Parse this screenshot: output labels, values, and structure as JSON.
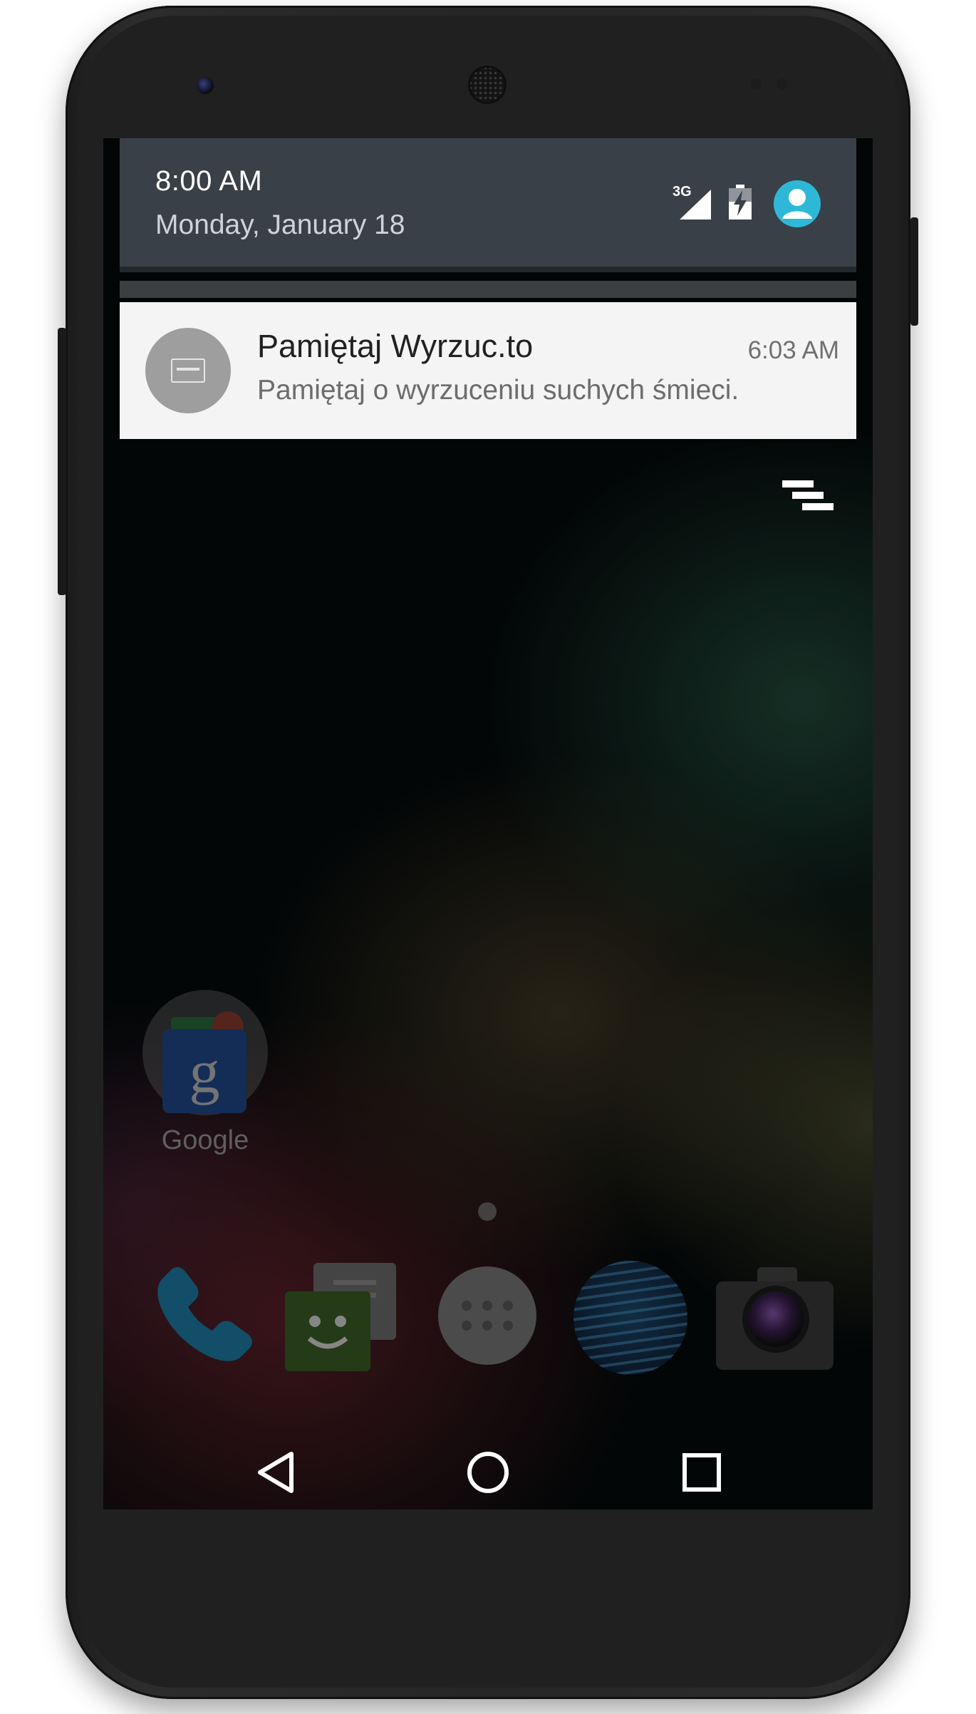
{
  "status": {
    "time": "8:00 AM",
    "date": "Monday, January 18",
    "network_label": "3G",
    "icons": [
      "signal-icon",
      "battery-charging-icon",
      "user-avatar-icon"
    ]
  },
  "notification": {
    "app_icon": "app-icon",
    "title": "Pamiętaj Wyrzuc.to",
    "time": "6:03 AM",
    "text": "Pamiętaj o wyrzuceniu suchych śmieci."
  },
  "clear_all_icon": "clear-all-icon",
  "home": {
    "folder_label": "Google",
    "folder_glyph": "g",
    "dock": [
      "phone-icon",
      "messenger-icon",
      "app-drawer-icon",
      "browser-icon",
      "camera-icon"
    ]
  },
  "navbar": {
    "buttons": [
      "back-icon",
      "home-icon",
      "recents-icon"
    ]
  },
  "colors": {
    "panel_header": "#394047",
    "notification_bg": "#f4f4f4",
    "avatar_accent": "#2db8d8"
  }
}
